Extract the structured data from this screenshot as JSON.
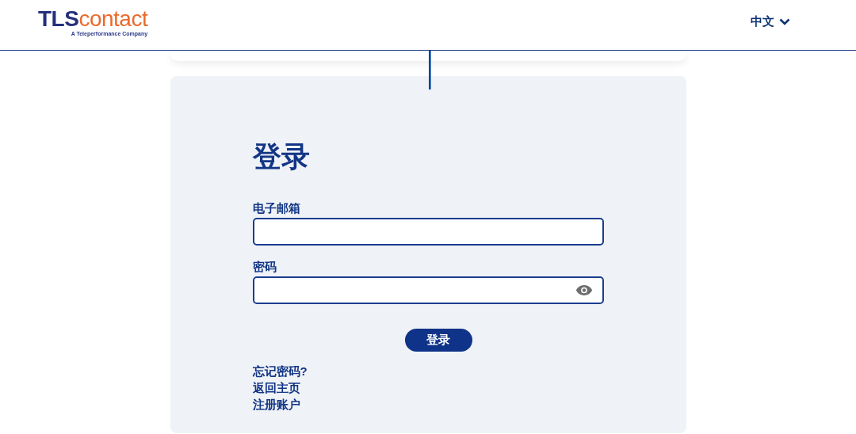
{
  "header": {
    "logo": {
      "brand_main": "TLS",
      "brand_accent": "contact",
      "tagline": "A Teleperformance Company"
    },
    "language": "中文"
  },
  "login": {
    "title": "登录",
    "fields": [
      {
        "label": "电子邮箱",
        "kind": "text"
      },
      {
        "label": "密码",
        "kind": "password"
      }
    ],
    "submit": "登录",
    "links": [
      "忘记密码?",
      "返回主页",
      "注册账户"
    ]
  }
}
